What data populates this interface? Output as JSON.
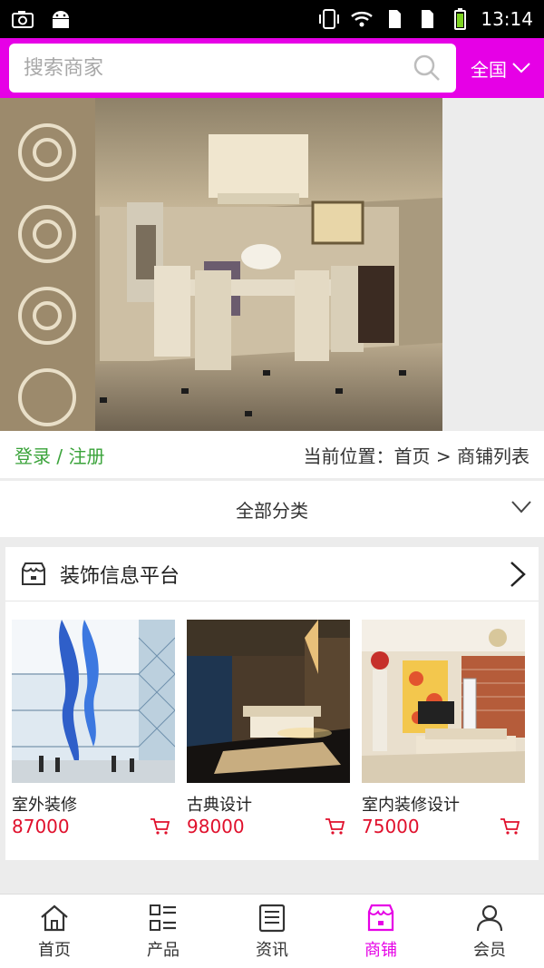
{
  "status_bar": {
    "time": "13:14"
  },
  "search": {
    "placeholder": "搜索商家",
    "region": "全国"
  },
  "login": {
    "label": "登录 / 注册"
  },
  "breadcrumb": {
    "text": "当前位置：首页 > 商铺列表"
  },
  "category": {
    "label": "全部分类"
  },
  "shop": {
    "name": "装饰信息平台",
    "products": [
      {
        "name": "室外装修",
        "price": "87000"
      },
      {
        "name": "古典设计",
        "price": "98000"
      },
      {
        "name": "室内装修设计",
        "price": "75000"
      }
    ]
  },
  "tabs": [
    {
      "label": "首页",
      "icon": "home-icon"
    },
    {
      "label": "产品",
      "icon": "list-icon"
    },
    {
      "label": "资讯",
      "icon": "news-icon"
    },
    {
      "label": "商铺",
      "icon": "shop-icon",
      "active": true
    },
    {
      "label": "会员",
      "icon": "user-icon"
    }
  ],
  "colors": {
    "accent": "#e600e6",
    "price": "#e0102c",
    "link": "#3aa33a"
  }
}
